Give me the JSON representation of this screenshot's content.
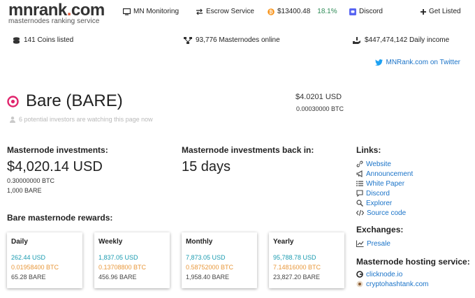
{
  "header": {
    "logo_main": "mnrank",
    "logo_dot": ".",
    "logo_tld": "com",
    "logo_sub": "masternodes ranking service",
    "nav": {
      "monitoring": "MN Monitoring",
      "escrow": "Escrow Service",
      "btc_price": "$13400.48",
      "btc_change": "18.1%",
      "discord": "Discord",
      "get_listed": "Get Listed"
    }
  },
  "stats": {
    "coins": "141 Coins listed",
    "masternodes": "93,776 Masternodes online",
    "income": "$447,474,142 Daily income"
  },
  "twitter": "MNRank.com on Twitter",
  "coin": {
    "name": "Bare (BARE)",
    "watchers": "6 potential investors are watching this page now",
    "price_usd": "$4.0201 USD",
    "price_btc": "0.00030000 BTC"
  },
  "investment": {
    "heading": "Masternode investments:",
    "usd": "$4,020.14 USD",
    "btc": "0.30000000 BTC",
    "coins": "1,000 BARE"
  },
  "back_in": {
    "heading": "Masternode investments back in:",
    "value": "15 days"
  },
  "rewards": {
    "heading": "Bare masternode rewards:",
    "cards": [
      {
        "period": "Daily",
        "usd": "262.44 USD",
        "btc": "0.01958400 BTC",
        "coin": "65.28 BARE"
      },
      {
        "period": "Weekly",
        "usd": "1,837.05 USD",
        "btc": "0.13708800 BTC",
        "coin": "456.96 BARE"
      },
      {
        "period": "Monthly",
        "usd": "7,873.05 USD",
        "btc": "0.58752000 BTC",
        "coin": "1,958.40 BARE"
      },
      {
        "period": "Yearly",
        "usd": "95,788.78 USD",
        "btc": "7.14816000 BTC",
        "coin": "23,827.20 BARE"
      }
    ]
  },
  "links": {
    "heading": "Links:",
    "items": [
      "Website",
      "Announcement",
      "White Paper",
      "Discord",
      "Explorer",
      "Source code"
    ]
  },
  "exchanges": {
    "heading": "Exchanges:",
    "items": [
      "Presale"
    ]
  },
  "hosting": {
    "heading": "Masternode hosting service:",
    "items": [
      "clicknode.io",
      "cryptohashtank.com"
    ]
  },
  "colors": {
    "accent_link": "#1a73c8",
    "usd": "#1a9bb0",
    "btc": "#e8973a",
    "logo_dot": "#e05a3c",
    "coin_icon": "#e0246c"
  }
}
